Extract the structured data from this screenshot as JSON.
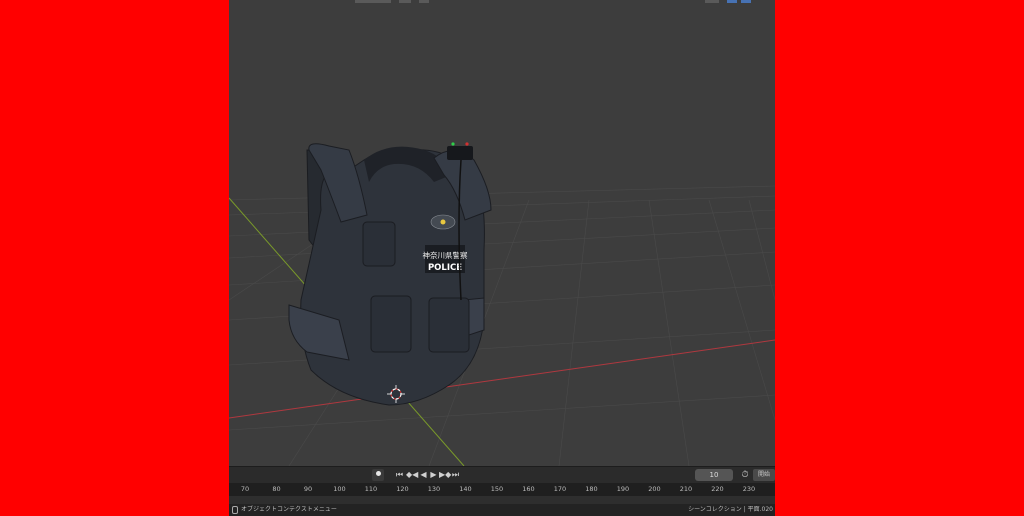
{
  "timeline": {
    "current_frame": "10",
    "start_label": "開始",
    "ruler_ticks": [
      "70",
      "80",
      "90",
      "100",
      "110",
      "120",
      "130",
      "140",
      "150",
      "160",
      "170",
      "180",
      "190",
      "200",
      "210",
      "220",
      "230"
    ]
  },
  "vest": {
    "badge_text": "神奈川県警察",
    "police_text": "POLICE"
  },
  "statusbar": {
    "left_text": "オブジェクトコンテクストメニュー",
    "right_text": "シーンコレクション | 平面.020"
  },
  "icons": {
    "record": "record-dot-icon",
    "jump_start": "jump-to-start-icon",
    "prev_keyframe": "prev-keyframe-icon",
    "play_reverse": "play-reverse-icon",
    "play": "play-icon",
    "next_keyframe": "next-keyframe-icon",
    "jump_end": "jump-to-end-icon",
    "clock": "clock-icon",
    "cursor3d": "3d-cursor-icon",
    "mouse": "mouse-icon"
  },
  "colors": {
    "background": "#ff0000",
    "viewport": "#3d3d3d",
    "x_axis": "#b0383f",
    "y_axis": "#7a9a2a"
  }
}
